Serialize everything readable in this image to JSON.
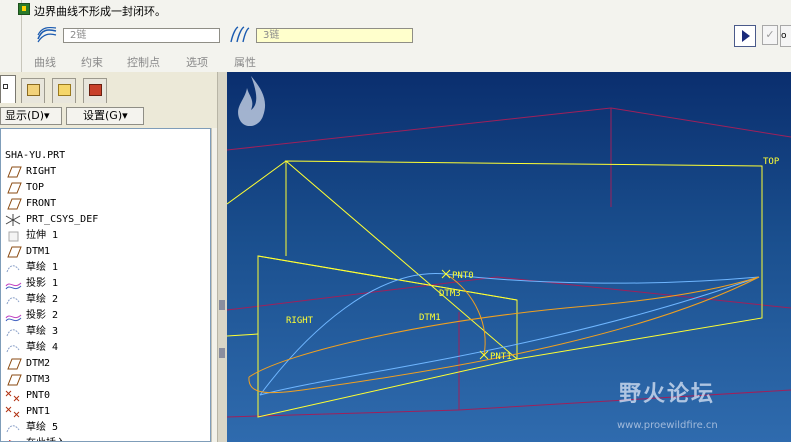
{
  "dashboard": {
    "message": "边界曲线不形成一封闭环。",
    "chain1_value": "2链",
    "chain2_value": "3链",
    "tabs": [
      "曲线",
      "约束",
      "控制点",
      "选项",
      "属性"
    ],
    "check_glyph": "✓",
    "glasses_glyph": "o"
  },
  "panel": {
    "show_label": "显示(D)▾",
    "settings_label": "设置(G)▾",
    "tree_root": "SHA-YU.PRT",
    "tree_items": [
      {
        "label": "RIGHT",
        "icon": "datum-plane-icon"
      },
      {
        "label": "TOP",
        "icon": "datum-plane-icon"
      },
      {
        "label": "FRONT",
        "icon": "datum-plane-icon"
      },
      {
        "label": "PRT_CSYS_DEF",
        "icon": "csys-icon"
      },
      {
        "label": "拉伸 1",
        "icon": "extrude-icon"
      },
      {
        "label": "DTM1",
        "icon": "datum-plane-icon"
      },
      {
        "label": "草绘 1",
        "icon": "sketch-icon"
      },
      {
        "label": "投影 1",
        "icon": "projection-icon"
      },
      {
        "label": "草绘 2",
        "icon": "sketch-icon"
      },
      {
        "label": "投影 2",
        "icon": "projection-icon"
      },
      {
        "label": "草绘 3",
        "icon": "sketch-icon"
      },
      {
        "label": "草绘 4",
        "icon": "sketch-icon"
      },
      {
        "label": "DTM2",
        "icon": "datum-plane-icon"
      },
      {
        "label": "DTM3",
        "icon": "datum-plane-icon"
      },
      {
        "label": "PNT0",
        "icon": "datum-point-icon"
      },
      {
        "label": "PNT1",
        "icon": "datum-point-icon"
      },
      {
        "label": "草绘 5",
        "icon": "sketch-icon"
      },
      {
        "label": "在此插入",
        "icon": "insert-here-icon"
      }
    ]
  },
  "viewport": {
    "labels": {
      "top": "TOP",
      "right": "RIGHT",
      "dtm1": "DTM1",
      "dtm3": "DTM3",
      "pnt0": "PNT0",
      "pnt1": "PNT1"
    },
    "watermark_title": "野火论坛",
    "watermark_url": "www.proewildfire.cn"
  },
  "colors": {
    "datum": "#ffff33",
    "curve_blue": "#6fb6ff",
    "curve_orange": "#f0a020",
    "frame": "#a0205a"
  }
}
